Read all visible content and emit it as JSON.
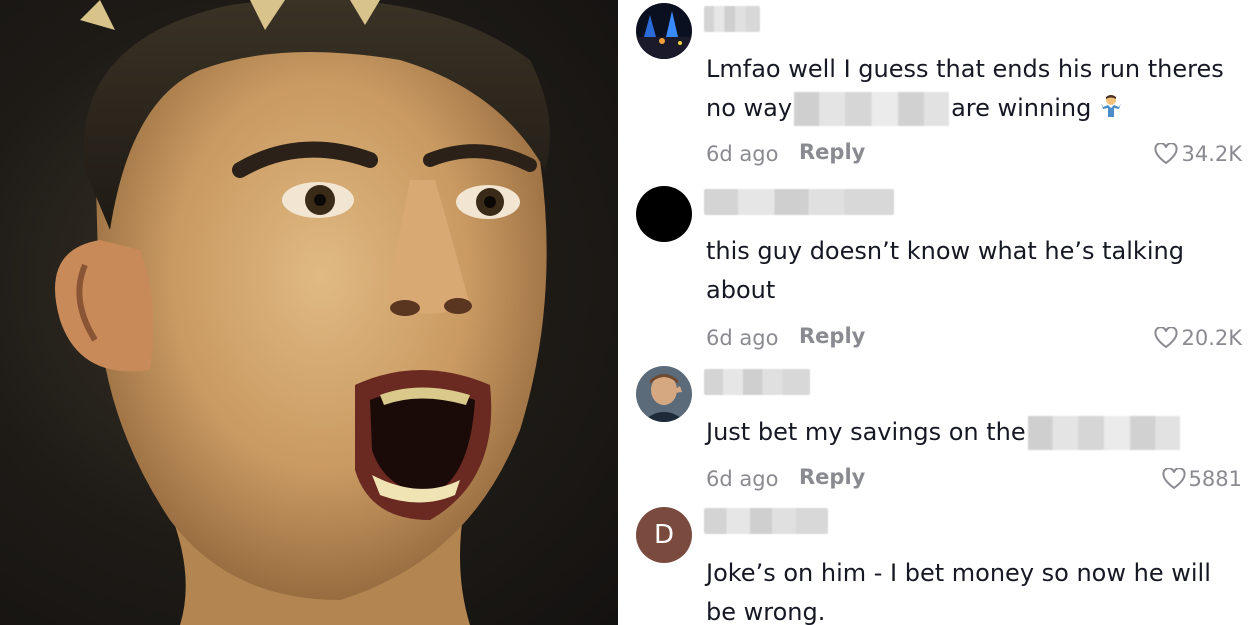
{
  "photo": {
    "subject_icon": "shouting-footballer-portrait"
  },
  "comments": [
    {
      "avatar": {
        "type": "image",
        "icon": "night-city-avatar"
      },
      "text_parts": [
        "Lmfao well I guess that ends his run theres",
        "no way",
        "are winning"
      ],
      "emoji": "person-shrugging",
      "time": "6d ago",
      "reply_label": "Reply",
      "likes": "34.2K"
    },
    {
      "avatar": {
        "type": "image",
        "icon": "black-circle-avatar"
      },
      "text": "this guy doesn’t know what he’s talking about",
      "time": "6d ago",
      "reply_label": "Reply",
      "likes": "20.2K"
    },
    {
      "avatar": {
        "type": "image",
        "icon": "man-portrait-avatar"
      },
      "text_parts": [
        "Just bet my savings on the"
      ],
      "time": "6d ago",
      "reply_label": "Reply",
      "likes": "5881"
    },
    {
      "avatar": {
        "type": "letter",
        "letter": "D",
        "color": "#7a4a3e"
      },
      "text": "Joke’s on him - I bet money so now he will be wrong."
    }
  ],
  "colors": {
    "text": "#161823",
    "meta": "#8a8b91",
    "avatar_letter_bg": "#7a4a3e"
  }
}
